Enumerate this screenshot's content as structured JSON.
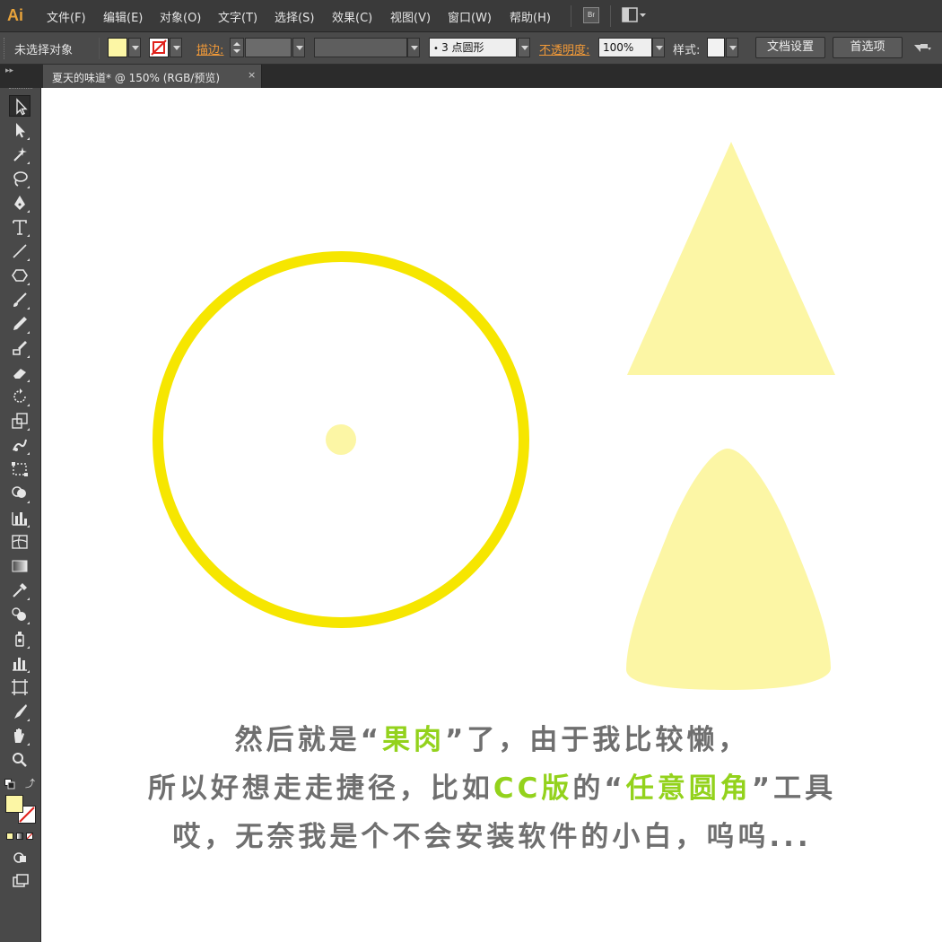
{
  "app": {
    "logo": "Ai"
  },
  "menu": {
    "items": [
      "文件(F)",
      "编辑(E)",
      "对象(O)",
      "文字(T)",
      "选择(S)",
      "效果(C)",
      "视图(V)",
      "窗口(W)",
      "帮助(H)"
    ],
    "bridge_label": "Br"
  },
  "controlbar": {
    "selection_status": "未选择对象",
    "fill_color": "#fcf6a5",
    "stroke_label": "描边:",
    "brush_value": "3 点圆形",
    "opacity_label": "不透明度:",
    "opacity_value": "100%",
    "style_label": "样式:",
    "doc_setup_button": "文档设置",
    "preferences_button": "首选项"
  },
  "document_tab": {
    "title": "夏天的味道* @ 150% (RGB/预览)",
    "close": "×"
  },
  "tools": [
    "selection-tool",
    "direct-selection-tool",
    "magic-wand-tool",
    "lasso-tool",
    "pen-tool",
    "type-tool",
    "line-segment-tool",
    "polygon-tool",
    "paintbrush-tool",
    "pencil-tool",
    "blob-brush-tool",
    "eraser-tool",
    "rotate-tool",
    "scale-tool",
    "warp-tool",
    "free-transform-tool",
    "shape-builder-tool",
    "graph-tool",
    "mesh-tool",
    "gradient-tool",
    "eyedropper-tool",
    "blend-tool",
    "symbol-sprayer-tool",
    "column-graph-tool",
    "artboard-tool",
    "slice-tool",
    "hand-tool",
    "zoom-tool"
  ],
  "colors": {
    "ring": "#f6e600",
    "pale_yellow": "#fcf6a5",
    "highlight": "#93d21c",
    "caption": "#6f6f6f"
  },
  "caption": {
    "line1": {
      "a": "然后就是“",
      "b": "果肉",
      "c": "”了，由于我比较懒，"
    },
    "line2": {
      "a": "所以好想走走捷径，比如",
      "b": "CC版",
      "c": "的“",
      "d": "任意圆角",
      "e": "”工具"
    },
    "line3": "哎，无奈我是个不会安装软件的小白，呜呜..."
  }
}
